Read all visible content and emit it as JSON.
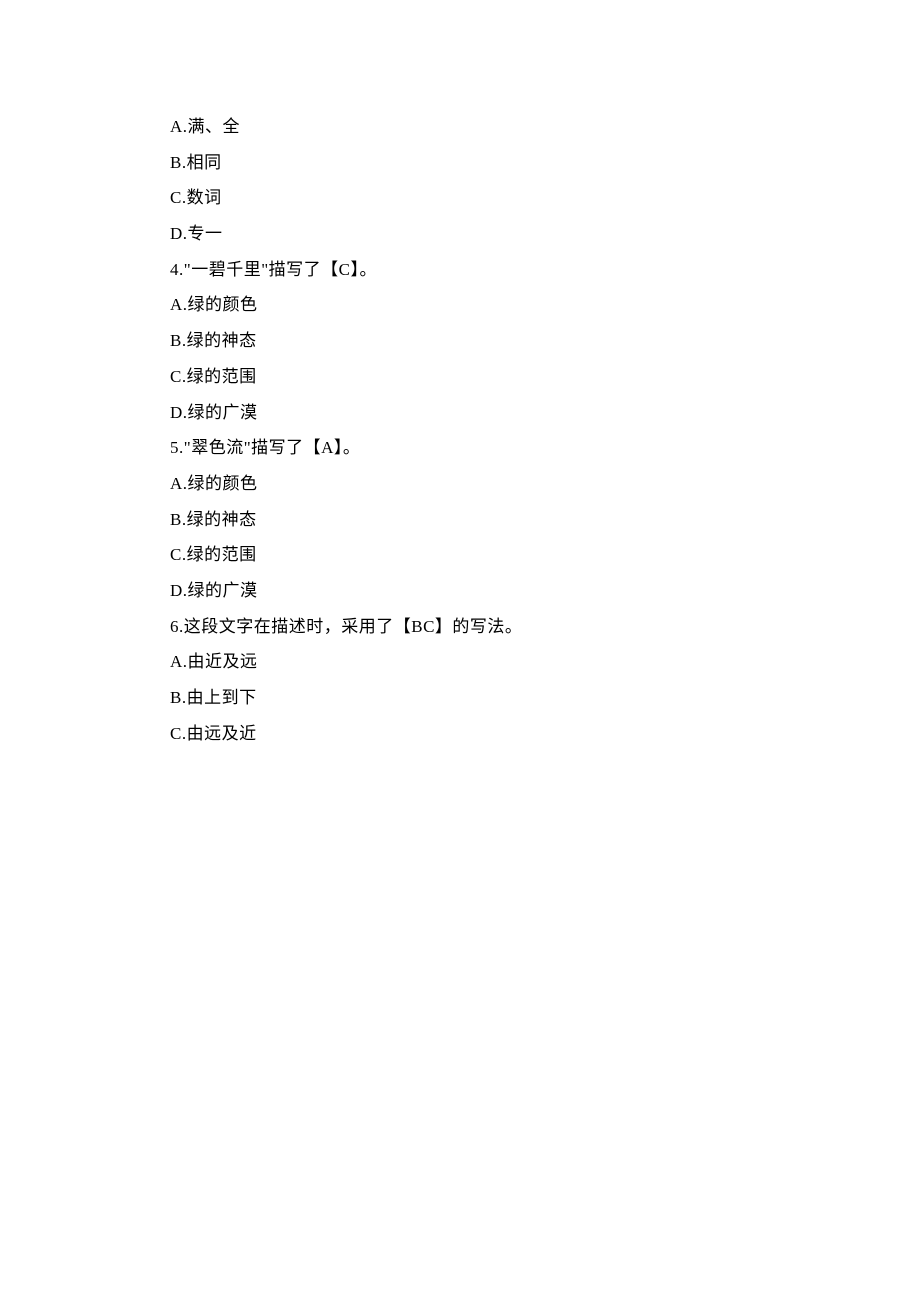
{
  "lines": [
    "A.满、全",
    "B.相同",
    "C.数词",
    "D.专一",
    "4.\"一碧千里\"描写了【C】。",
    "A.绿的颜色",
    "B.绿的神态",
    "C.绿的范围",
    "D.绿的广漠",
    "5.\"翠色流\"描写了【A】。",
    "A.绿的颜色",
    "B.绿的神态",
    "C.绿的范围",
    "D.绿的广漠",
    "6.这段文字在描述时，采用了【BC】的写法。",
    "A.由近及远",
    "B.由上到下",
    "C.由远及近"
  ]
}
